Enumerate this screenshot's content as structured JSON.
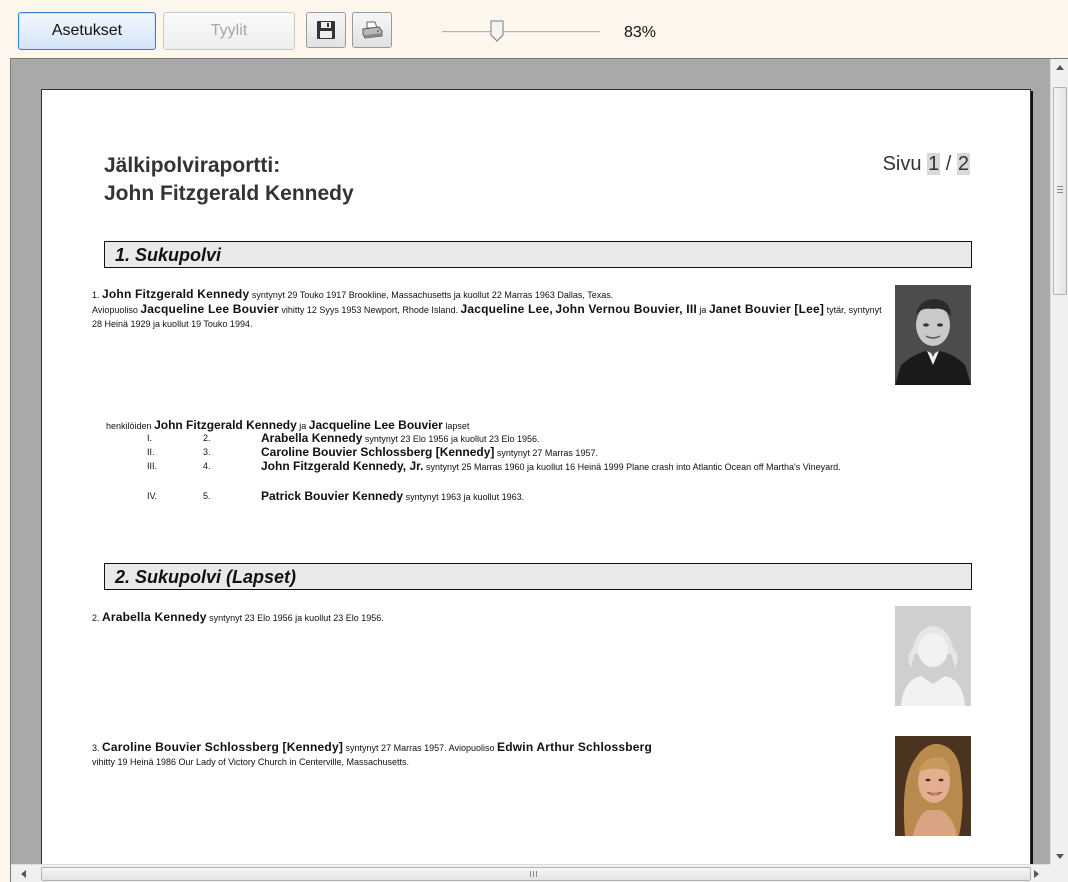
{
  "toolbar": {
    "settings_label": "Asetukset",
    "styles_label": "Tyylit",
    "zoom_value": 83,
    "zoom_label": "83%"
  },
  "report": {
    "title_line1": "Jälkipolviraportti:",
    "title_line2": "John Fitzgerald Kennedy",
    "page_prefix": "Sivu",
    "page_current": "1",
    "page_sep": "/",
    "page_total": "2"
  },
  "sections": [
    {
      "title": "1. Sukupolvi"
    },
    {
      "title": "2. Sukupolvi (Lapset)"
    }
  ],
  "person1": {
    "number": "1.",
    "name": "John Fitzgerald Kennedy",
    "text1": "syntynyt 29 Touko 1917 Brookline, Massachusetts ja kuollut 22 Marras 1963 Dallas, Texas.",
    "spouse_prefix": "Aviopuoliso",
    "spouse_name": "Jacqueline Lee Bouvier",
    "text2": "vihitty 12 Syys 1953 Newport, Rhode Island.",
    "parent1": "Jacqueline Lee",
    "parent2": "John Vernou Bouvier, III",
    "and": "ja",
    "parent3": "Janet Bouvier [Lee]",
    "text3": "tytär, syntynyt 28 Heinä 1929 ja kuollut 19 Touko 1994."
  },
  "children_intro": {
    "prefix": "henkilöiden",
    "name1": "John Fitzgerald Kennedy",
    "and": "ja",
    "name2": "Jacqueline Lee Bouvier",
    "suffix": "lapset"
  },
  "children": [
    {
      "roman": "I.",
      "number": "2.",
      "name": "Arabella Kennedy",
      "text": "syntynyt 23 Elo 1956 ja kuollut 23 Elo 1956."
    },
    {
      "roman": "II.",
      "number": "3.",
      "name": "Caroline Bouvier Schlossberg [Kennedy]",
      "text": "syntynyt 27 Marras 1957."
    },
    {
      "roman": "III.",
      "number": "4.",
      "name": "John Fitzgerald Kennedy, Jr.",
      "text": "syntynyt 25 Marras 1960 ja kuollut 16 Heinä 1999 Plane crash into Atlantic Ocean off Martha's Vineyard."
    },
    {
      "roman": "IV.",
      "number": "5.",
      "name": "Patrick Bouvier Kennedy",
      "text": "syntynyt 1963 ja kuollut 1963."
    }
  ],
  "person2": {
    "number": "2.",
    "name": "Arabella Kennedy",
    "text": "syntynyt 23 Elo 1956 ja kuollut 23 Elo 1956."
  },
  "person3": {
    "number": "3.",
    "name": "Caroline Bouvier Schlossberg [Kennedy]",
    "text1": "syntynyt 27 Marras 1957.",
    "spouse_prefix": "Aviopuoliso",
    "spouse_name": "Edwin Arthur Schlossberg",
    "text2": "vihitty 19 Heinä 1986 Our Lady of Victory Church in Centerville, Massachusetts."
  },
  "colors": {
    "section_bg": "#e9e9e9",
    "viewer_bg": "#a9a9a9",
    "primary_border": "#3f7fd2"
  }
}
